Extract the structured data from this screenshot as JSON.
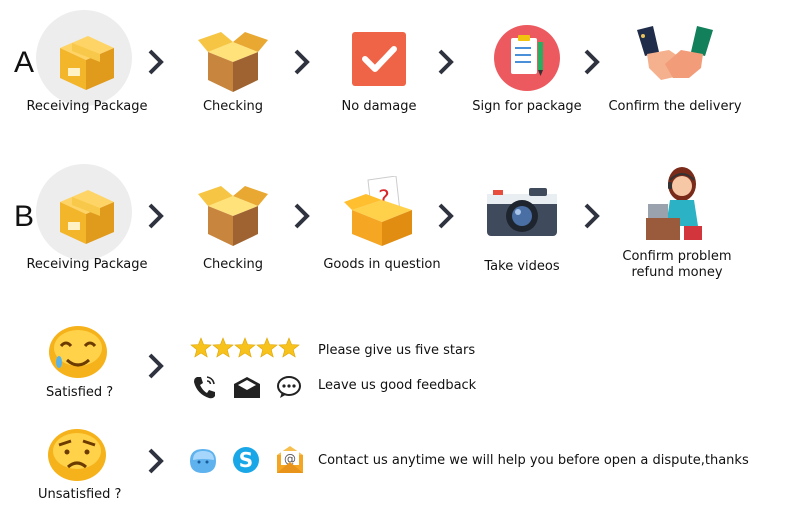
{
  "row_a": {
    "letter": "A",
    "steps": [
      {
        "label": "Receiving Package",
        "icon": "package-box-icon"
      },
      {
        "label": "Checking",
        "icon": "open-box-icon"
      },
      {
        "label": "No damage",
        "icon": "check-badge-icon"
      },
      {
        "label": "Sign for package",
        "icon": "clipboard-sign-icon"
      },
      {
        "label": "Confirm the delivery",
        "icon": "handshake-icon"
      }
    ]
  },
  "row_b": {
    "letter": "B",
    "steps": [
      {
        "label": "Receiving Package",
        "icon": "package-box-icon"
      },
      {
        "label": "Checking",
        "icon": "open-box-icon"
      },
      {
        "label": "Goods in question",
        "icon": "question-box-icon"
      },
      {
        "label": "Take videos",
        "icon": "camera-icon"
      },
      {
        "label": "Confirm problem refund money",
        "icon": "support-agent-icon"
      }
    ]
  },
  "satisfied": {
    "label": "Satisfied ?",
    "stars_text": "Please give us five stars",
    "feedback_text": "Leave us good feedback",
    "stars": 5
  },
  "unsatisfied": {
    "label": "Unsatisfied ?",
    "contact_text": "Contact us anytime we will help you before open a dispute,thanks"
  },
  "colors": {
    "box_gold": "#f3b52a",
    "box_brown": "#b2773e",
    "check_red": "#ef6446",
    "star_yellow": "#f6c21b",
    "skype_blue": "#1aa7e7",
    "arrow": "#2f3340"
  }
}
